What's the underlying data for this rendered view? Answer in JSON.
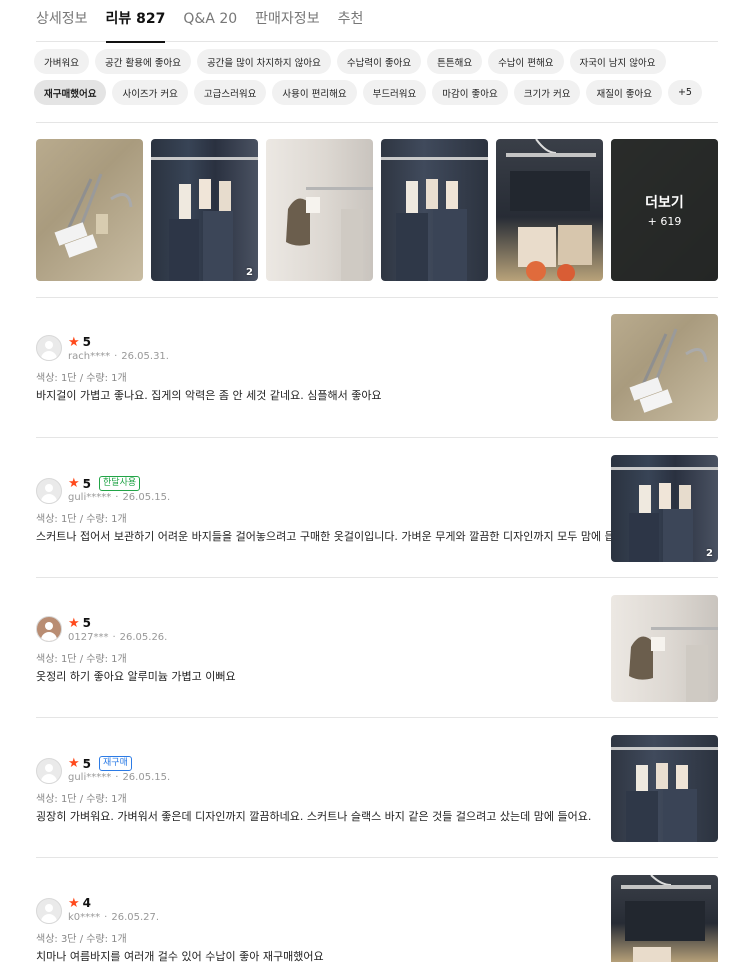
{
  "tabs": [
    {
      "label": "상세정보"
    },
    {
      "label": "리뷰 827"
    },
    {
      "label": "Q&A 20"
    },
    {
      "label": "판매자정보"
    },
    {
      "label": "추천"
    }
  ],
  "keywords_row1": [
    "가벼워요",
    "공간 활용에 좋아요",
    "공간을 많이 차지하지 않아요",
    "수납력이 좋아요",
    "튼튼해요",
    "수납이 편해요",
    "자국이 남지 않아요"
  ],
  "keywords_row2": [
    "재구매했어요",
    "사이즈가 커요",
    "고급스러워요",
    "사용이 편리해요",
    "부드러워요",
    "마감이 좋아요",
    "크기가 커요",
    "재질이 좋아요",
    "+5"
  ],
  "photo_grid": {
    "badge_count": "2",
    "more_title": "더보기",
    "more_count": "+ 619"
  },
  "reviews": [
    {
      "rating": "5",
      "tag": "",
      "user": "rach****",
      "date": "26.05.31.",
      "option": "색상: 1단 / 수량: 1개",
      "text": "바지걸이 가볍고 좋나요. 집게의 악력은 좀 안 세것 같네요. 심플해서 좋아요",
      "photo_badge": ""
    },
    {
      "rating": "5",
      "tag": "한달사용",
      "user": "guli*****",
      "date": "26.05.15.",
      "option": "색상: 1단 / 수량: 1개",
      "text": "스커트나 접어서 보관하기 어려운 바지들을 걸어놓으려고 구매한 옷걸이입니다. 가벼운 무게와 깔끔한 디자인까지 모두 맘에 듭니다.",
      "photo_badge": "2"
    },
    {
      "rating": "5",
      "tag": "",
      "user": "0127***",
      "date": "26.05.26.",
      "option": "색상: 1단 / 수량: 1개",
      "text": "옷정리 하기 좋아요 알루미늄 가볍고 이뻐요",
      "photo_badge": ""
    },
    {
      "rating": "5",
      "tag": "재구매",
      "user": "guli*****",
      "date": "26.05.15.",
      "option": "색상: 1단 / 수량: 1개",
      "text": "굉장히 가벼워요. 가벼워서 좋은데 디자인까지 깔끔하네요. 스커트나 슬랙스 바지 같은 것들 걸으려고 샀는데 맘에 들어요.",
      "photo_badge": ""
    },
    {
      "rating": "4",
      "tag": "",
      "user": "k0****",
      "date": "26.05.27.",
      "option": "색상: 3단 / 수량: 1개",
      "text": "치마나 여름바지를 여러개 걸수 있어 수납이 좋아 재구매했어요",
      "photo_badge": ""
    }
  ],
  "icons": {
    "star": "star-icon",
    "avatar": "user-avatar-icon"
  },
  "colors": {
    "star": "#ff4a1c",
    "tag_green": "#22a447",
    "tag_blue": "#2c7be5"
  }
}
